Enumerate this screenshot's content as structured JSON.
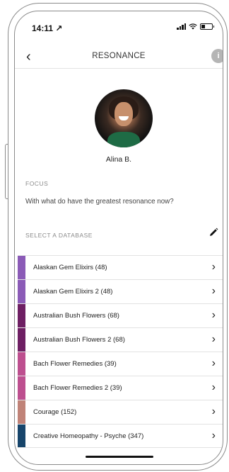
{
  "status_bar": {
    "time": "14:11 ↗"
  },
  "nav": {
    "back_icon": "‹",
    "title": "RESONANCE",
    "info_icon": "i"
  },
  "profile": {
    "name": "Alina B."
  },
  "focus": {
    "label": "FOCUS",
    "text": "With what do have the greatest resonance now?"
  },
  "database_section": {
    "label": "SELECT A DATABASE"
  },
  "databases": [
    {
      "name": "Alaskan Gem Elixirs (48)",
      "color": "#8b5bb7"
    },
    {
      "name": "Alaskan Gem Elixirs 2 (48)",
      "color": "#8b5bb7"
    },
    {
      "name": "Australian Bush Flowers (68)",
      "color": "#6e1f63"
    },
    {
      "name": "Australian Bush Flowers 2 (68)",
      "color": "#6e1f63"
    },
    {
      "name": "Bach Flower Remedies (39)",
      "color": "#bd4f8f"
    },
    {
      "name": "Bach Flower Remedies 2 (39)",
      "color": "#bd4f8f"
    },
    {
      "name": "Courage (152)",
      "color": "#c08378"
    },
    {
      "name": "Creative Homeopathy - Psyche (347)",
      "color": "#17456b"
    }
  ]
}
